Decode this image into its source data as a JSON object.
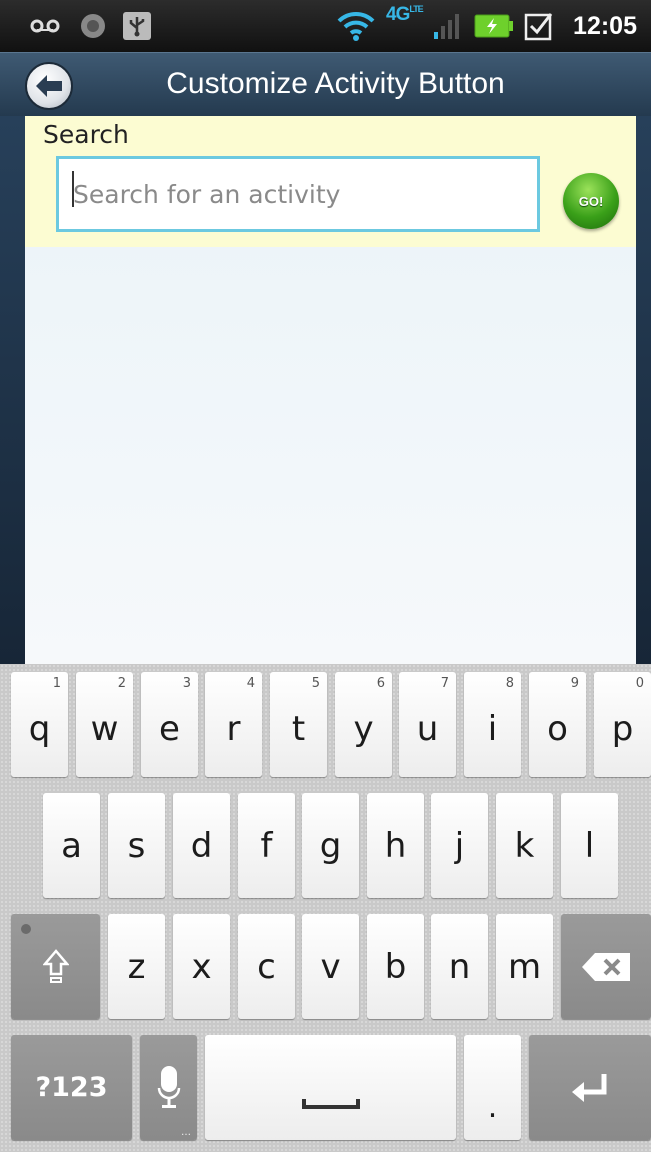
{
  "status_bar": {
    "time": "12:05",
    "network": "4G",
    "network_sub": "LTE",
    "icons": [
      "voicemail-icon",
      "circle-icon",
      "usb-icon",
      "wifi-icon",
      "signal-icon",
      "battery-charging-icon",
      "checkbox-icon"
    ]
  },
  "title_bar": {
    "title": "Customize Activity Button",
    "back_icon": "back-arrow-icon"
  },
  "search": {
    "label": "Search",
    "placeholder": "Search for an activity",
    "value": "",
    "go_label": "GO!"
  },
  "keyboard": {
    "row1": [
      {
        "key": "q",
        "hint": "1"
      },
      {
        "key": "w",
        "hint": "2"
      },
      {
        "key": "e",
        "hint": "3"
      },
      {
        "key": "r",
        "hint": "4"
      },
      {
        "key": "t",
        "hint": "5"
      },
      {
        "key": "y",
        "hint": "6"
      },
      {
        "key": "u",
        "hint": "7"
      },
      {
        "key": "i",
        "hint": "8"
      },
      {
        "key": "o",
        "hint": "9"
      },
      {
        "key": "p",
        "hint": "0"
      }
    ],
    "row2": [
      "a",
      "s",
      "d",
      "f",
      "g",
      "h",
      "j",
      "k",
      "l"
    ],
    "row3": [
      "z",
      "x",
      "c",
      "v",
      "b",
      "n",
      "m"
    ],
    "symbols_label": "?123",
    "period_label": ".",
    "icons": [
      "shift-icon",
      "backspace-icon",
      "microphone-icon",
      "space-icon",
      "enter-icon"
    ]
  },
  "colors": {
    "title_bar": "#2f4962",
    "search_area": "#fcfcd2",
    "input_border": "#6cc9e0",
    "go_button": "#3aa019",
    "network_accent": "#37b7e6",
    "battery": "#6ed02c"
  }
}
